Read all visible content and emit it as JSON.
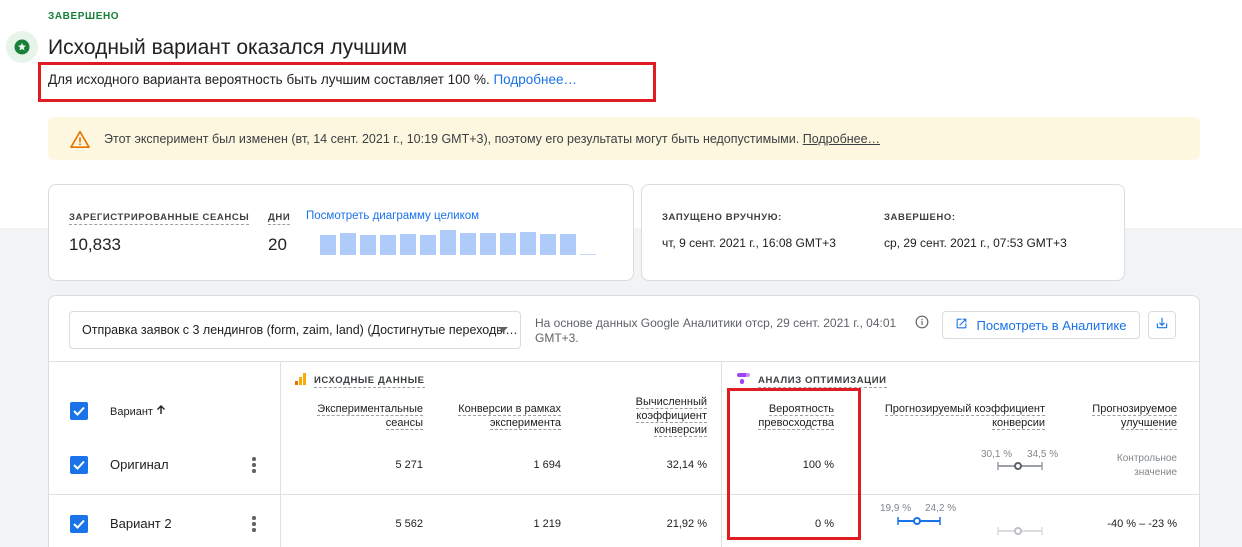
{
  "header": {
    "status": "ЗАВЕРШЕНО",
    "title": "Исходный вариант оказался лучшим",
    "subtitle": "Для исходного варианта вероятность быть лучшим составляет 100 %.",
    "subtitle_link": "Подробнее…"
  },
  "warning": {
    "text": "Этот эксперимент был изменен (вт, 14 сент. 2021 г., 10:19 GMT+3), поэтому его результаты могут быть недопустимыми.",
    "link": "Подробнее…"
  },
  "stats": {
    "sessions_label": "ЗАРЕГИСТРИРОВАННЫЕ СЕАНСЫ",
    "sessions_value": "10,833",
    "days_label": "ДНИ",
    "days_value": "20",
    "chart_link": "Посмотреть диаграмму целиком",
    "mini_chart_daily_relative": [
      0.75,
      0.85,
      0.75,
      0.75,
      0.8,
      0.75,
      0.95,
      0.85,
      0.85,
      0.85,
      0.9,
      0.8,
      0.8,
      0.05
    ]
  },
  "schedule": {
    "started_label": "ЗАПУЩЕНО ВРУЧНУЮ:",
    "started_value": "чт, 9 сент. 2021 г., 16:08 GMT+3",
    "ended_label": "ЗАВЕРШЕНО:",
    "ended_value": "ср, 29 сент. 2021 г., 07:53 GMT+3"
  },
  "toolbar": {
    "objective": "Отправка заявок с 3 лендингов (form, zaim, land) (Достигнутые переходы…",
    "source_note": "На основе данных Google Аналитики отср, 29 сент. 2021 г., 04:01 GMT+3.",
    "analytics_button": "Посмотреть в Аналитике"
  },
  "table": {
    "section_source": "ИСХОДНЫЕ ДАННЫЕ",
    "section_analysis": "АНАЛИЗ ОПТИМИЗАЦИИ",
    "col_variant": "Вариант",
    "col_sessions": [
      "Экспериментальные",
      "сеансы"
    ],
    "col_conversions": [
      "Конверсии в рамках",
      "эксперимента"
    ],
    "col_rate": [
      "Вычисленный",
      "коэффициент",
      "конверсии"
    ],
    "col_prob": [
      "Вероятность",
      "превосходства"
    ],
    "col_model_rate": [
      "Прогнозируемый коэффициент",
      "конверсии"
    ],
    "col_improvement": [
      "Прогнозируемое",
      "улучшение"
    ],
    "rows": [
      {
        "name": "Оригинал",
        "sessions": "5 271",
        "conversions": "1 694",
        "rate": "32,14 %",
        "prob": "100 %",
        "range_low": "30,1 %",
        "range_high": "34,5 %",
        "improvement": [
          "Контрольное",
          "значение"
        ]
      },
      {
        "name": "Вариант 2",
        "sessions": "5 562",
        "conversions": "1 219",
        "rate": "21,92 %",
        "prob": "0 %",
        "range_low": "19,9 %",
        "range_high": "24,2 %",
        "improvement": "-40 % – -23 %"
      }
    ]
  },
  "colors": {
    "accent": "#1a73e8",
    "success": "#188038",
    "warning_bg": "#fef7e0",
    "highlight": "#e01b22"
  }
}
